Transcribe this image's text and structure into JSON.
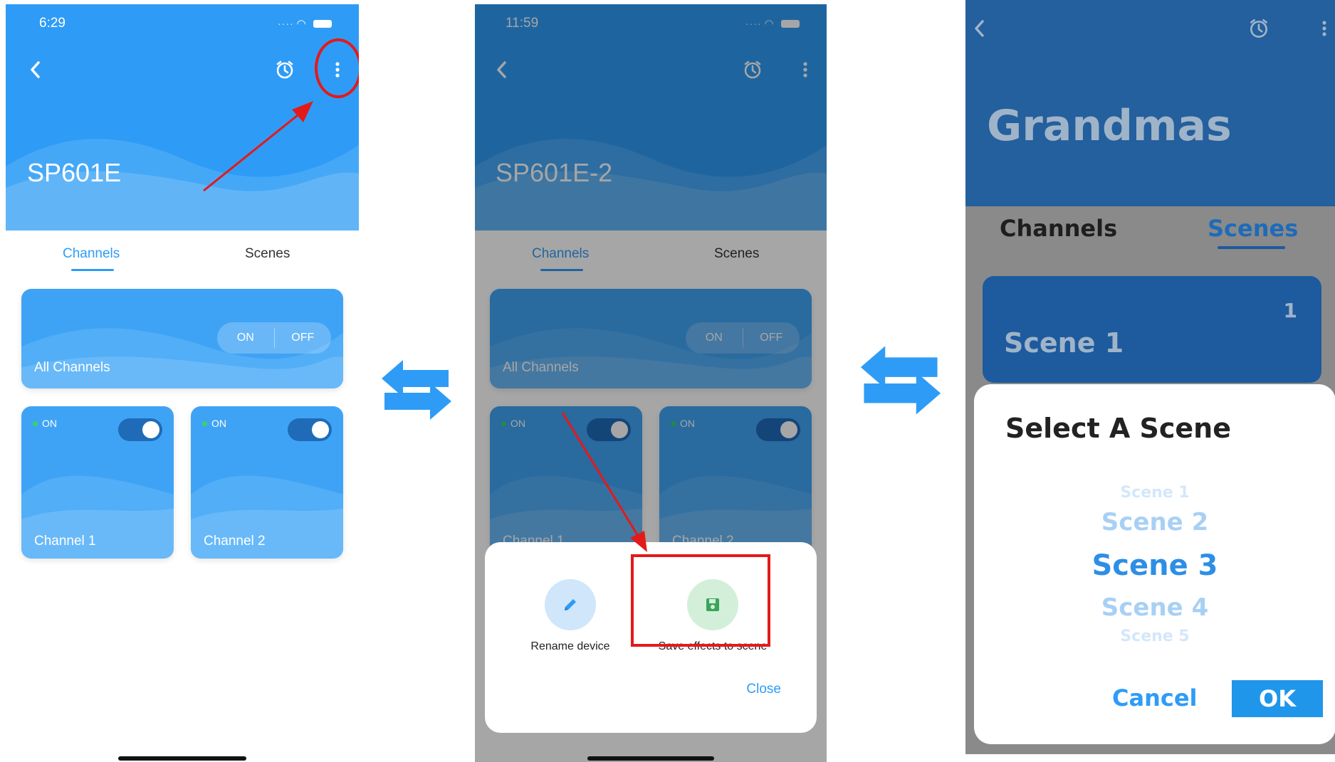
{
  "colors": {
    "accent": "#2e9cf6",
    "annotation": "#e31a1a",
    "header_dim": "#245f9e"
  },
  "screen1": {
    "status_time": "6:29",
    "device_name": "SP601E",
    "tabs": [
      {
        "label": "Channels",
        "active": true
      },
      {
        "label": "Scenes",
        "active": false
      }
    ],
    "all_channels": {
      "label": "All Channels",
      "on_label": "ON",
      "off_label": "OFF"
    },
    "channels": [
      {
        "status": "ON",
        "label": "Channel 1",
        "toggle_on": true
      },
      {
        "status": "ON",
        "label": "Channel 2",
        "toggle_on": true
      }
    ],
    "icons": {
      "back": "chevron-left-icon",
      "alarm": "alarm-clock-icon",
      "more": "more-vertical-icon"
    }
  },
  "screen2": {
    "status_time": "11:59",
    "device_name": "SP601E-2",
    "tabs": [
      {
        "label": "Channels",
        "active": true
      },
      {
        "label": "Scenes",
        "active": false
      }
    ],
    "all_channels": {
      "label": "All Channels",
      "on_label": "ON",
      "off_label": "OFF"
    },
    "channels": [
      {
        "status": "ON",
        "label": "Channel 1"
      },
      {
        "status": "ON",
        "label": "Channel 2"
      }
    ],
    "sheet": {
      "actions": [
        {
          "label": "Rename device",
          "icon": "pencil-icon"
        },
        {
          "label": "Save effects to scene",
          "icon": "floppy-disk-icon"
        }
      ],
      "close_label": "Close"
    }
  },
  "screen3": {
    "device_name": "Grandmas",
    "tabs": [
      {
        "label": "Channels",
        "active": false
      },
      {
        "label": "Scenes",
        "active": true
      }
    ],
    "scene_card": {
      "label": "Scene 1",
      "number": "1"
    },
    "dialog": {
      "title": "Select A Scene",
      "options": [
        "Scene 1",
        "Scene 2",
        "Scene 3",
        "Scene 4",
        "Scene 5"
      ],
      "selected": "Scene 3",
      "cancel_label": "Cancel",
      "ok_label": "OK"
    }
  }
}
